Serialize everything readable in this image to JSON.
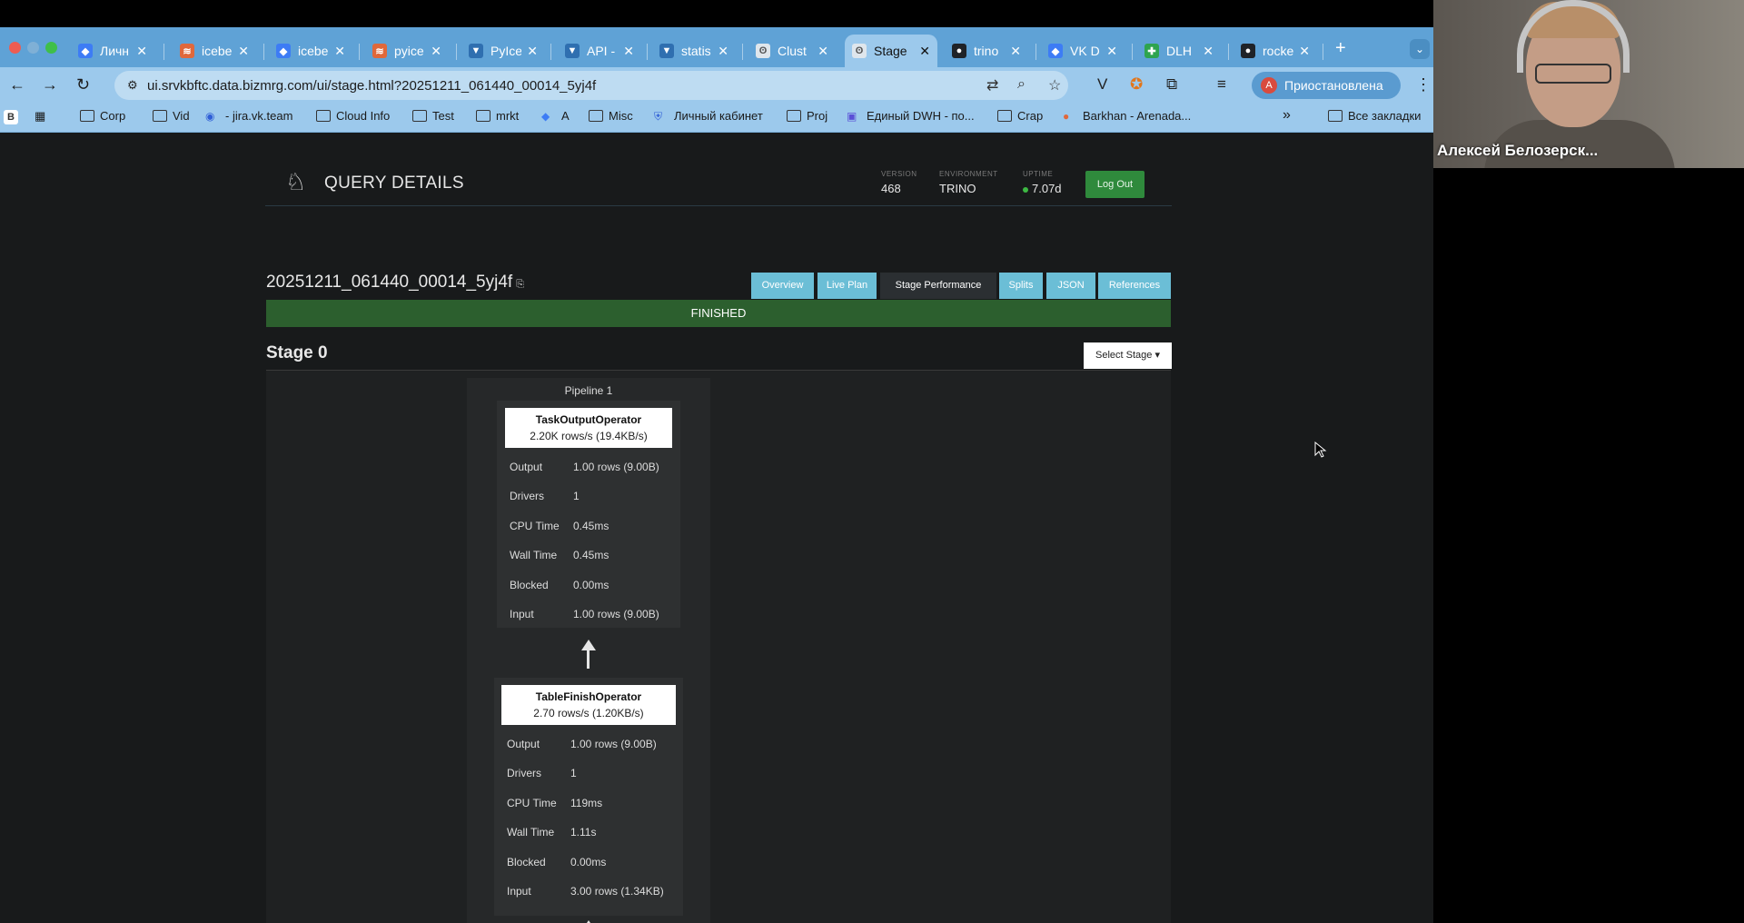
{
  "browser": {
    "tabs": [
      {
        "label": "Личн",
        "favicon": "cube-icon"
      },
      {
        "label": "icebe",
        "favicon": "iceberg-icon"
      },
      {
        "label": "icebe",
        "favicon": "cube-icon"
      },
      {
        "label": "pyice",
        "favicon": "iceberg-icon"
      },
      {
        "label": "PyIce",
        "favicon": "pyiceberg-icon"
      },
      {
        "label": "API -",
        "favicon": "pyiceberg-icon"
      },
      {
        "label": "statis",
        "favicon": "pyiceberg-icon"
      },
      {
        "label": "Clust",
        "favicon": "trino-bunny-icon"
      },
      {
        "label": "Stage",
        "favicon": "trino-bunny-icon",
        "active": true
      },
      {
        "label": "trino",
        "favicon": "github-icon"
      },
      {
        "label": "VK D",
        "favicon": "cube-icon"
      },
      {
        "label": "DLH",
        "favicon": "plus-cross-icon"
      },
      {
        "label": "rocke",
        "favicon": "github-icon"
      }
    ],
    "url": "ui.srvkbftc.data.bizmrg.com/ui/stage.html?20251211_061440_00014_5yj4f",
    "profile": {
      "initial": "A",
      "label": "Приостановлена"
    },
    "bookmarks": [
      {
        "label": "B",
        "icon": "b-badge-icon"
      },
      {
        "label": "",
        "icon": "apps-grid-icon"
      },
      {
        "label": "Corp",
        "icon": "folder-icon"
      },
      {
        "label": "Vid",
        "icon": "folder-icon"
      },
      {
        "label": "- jira.vk.team",
        "icon": "jira-icon"
      },
      {
        "label": "Cloud Info",
        "icon": "folder-icon"
      },
      {
        "label": "Test",
        "icon": "folder-icon"
      },
      {
        "label": "mrkt",
        "icon": "folder-icon"
      },
      {
        "label": "A",
        "icon": "cube-icon"
      },
      {
        "label": "Misc",
        "icon": "folder-icon"
      },
      {
        "label": "Личный кабинет",
        "icon": "shield-icon"
      },
      {
        "label": "Proj",
        "icon": "folder-icon"
      },
      {
        "label": "Единый DWH - по...",
        "icon": "grid-icon"
      },
      {
        "label": "Crap",
        "icon": "folder-icon"
      },
      {
        "label": "Barkhan - Arenada...",
        "icon": "arenadata-icon"
      }
    ],
    "more_bookmarks": "»",
    "all_bookmarks": "Все закладки"
  },
  "header": {
    "title": "QUERY DETAILS",
    "version_label": "VERSION",
    "version": "468",
    "environment_label": "ENVIRONMENT",
    "environment": "TRINO",
    "uptime_label": "UPTIME",
    "uptime": "7.07d",
    "logout": "Log Out"
  },
  "query": {
    "id": "20251211_061440_00014_5yj4f",
    "status": "FINISHED",
    "tabs": [
      "Overview",
      "Live Plan",
      "Stage Performance",
      "Splits",
      "JSON",
      "References"
    ],
    "active_tab": "Stage Performance"
  },
  "stage": {
    "title": "Stage 0",
    "select_label": "Select Stage ▾",
    "pipeline_title": "Pipeline 1",
    "operators": [
      {
        "name": "TaskOutputOperator",
        "rate": "2.20K rows/s (19.4KB/s)",
        "metrics": [
          {
            "k": "Output",
            "v": "1.00 rows (9.00B)"
          },
          {
            "k": "Drivers",
            "v": "1"
          },
          {
            "k": "CPU Time",
            "v": "0.45ms"
          },
          {
            "k": "Wall Time",
            "v": "0.45ms"
          },
          {
            "k": "Blocked",
            "v": "0.00ms"
          },
          {
            "k": "Input",
            "v": "1.00 rows (9.00B)"
          }
        ]
      },
      {
        "name": "TableFinishOperator",
        "rate": "2.70 rows/s (1.20KB/s)",
        "metrics": [
          {
            "k": "Output",
            "v": "1.00 rows (9.00B)"
          },
          {
            "k": "Drivers",
            "v": "1"
          },
          {
            "k": "CPU Time",
            "v": "119ms"
          },
          {
            "k": "Wall Time",
            "v": "1.11s"
          },
          {
            "k": "Blocked",
            "v": "0.00ms"
          },
          {
            "k": "Input",
            "v": "3.00 rows (1.34KB)"
          }
        ]
      }
    ]
  },
  "webcam": {
    "name": "Алексей Белозерск..."
  },
  "colors": {
    "tab_bar": "#5fa2d6",
    "status_finished": "#2c5f2e",
    "nav_tab": "#6bbed6",
    "logout_button": "#2f8a3c"
  }
}
